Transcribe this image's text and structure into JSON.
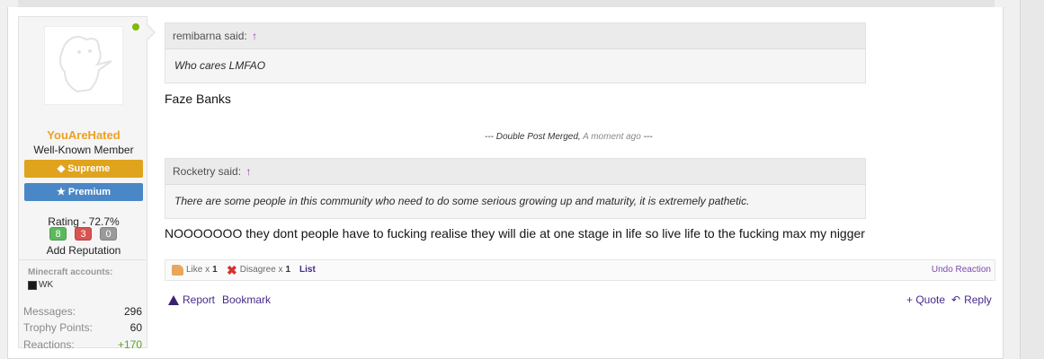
{
  "user": {
    "username": "YouAreHated",
    "title": "Well-Known Member",
    "banners": [
      {
        "icon": "diamond-icon",
        "label": "Supreme",
        "color": "#e0a31d"
      },
      {
        "icon": "trophy-icon",
        "label": "Premium",
        "color": "#4a87c6"
      }
    ],
    "rating": "Rating - 72.7%",
    "rating_counts": {
      "positive": "8",
      "negative": "3",
      "neutral": "0"
    },
    "add_reputation": "Add Reputation",
    "minecraft_title": "Minecraft accounts:",
    "minecraft_account": "WK",
    "stats": [
      {
        "key": "Messages:",
        "value": "296"
      },
      {
        "key": "Trophy Points:",
        "value": "60"
      },
      {
        "key": "Reactions:",
        "value": "+170"
      }
    ],
    "online_color": "#7fb900"
  },
  "quotes": [
    {
      "author": "remibarna said:",
      "text": "Who cares LMFAO"
    },
    {
      "author": "Rocketry said:",
      "text": "There are some people in this community who need to do some serious growing up and maturity, it is extremely pathetic."
    }
  ],
  "messages": {
    "first": "Faze Banks",
    "merged_label": "--- Double Post Merged,",
    "merged_time": "A moment ago",
    "merged_end": "---",
    "second": "NOOOOOOO they dont people have to fucking realise they will die at one stage in life so live life to the fucking max my nigger"
  },
  "reactions": {
    "like_label": "Like x",
    "like_count": "1",
    "disagree_label": "Disagree x",
    "disagree_count": "1",
    "list": "List",
    "undo": "Undo Reaction"
  },
  "actions": {
    "report": "Report",
    "bookmark": "Bookmark",
    "quote": "+ Quote",
    "reply": "Reply"
  },
  "colors": {
    "username": "#f0a020",
    "link": "#4a2a8a",
    "positive": "#5aa02c"
  }
}
